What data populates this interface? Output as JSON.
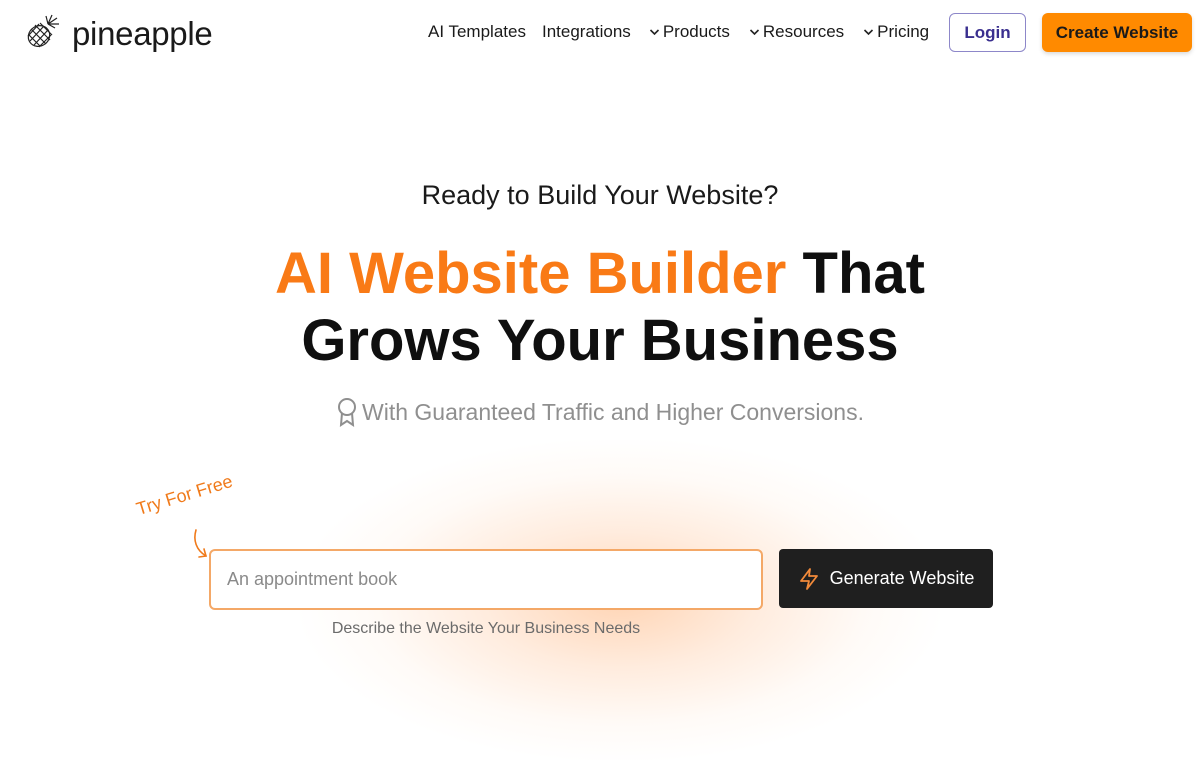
{
  "brand": {
    "name": "pineapple",
    "logo_icon": "pineapple-icon"
  },
  "nav": {
    "items": [
      {
        "label": "AI Templates",
        "has_dropdown": false
      },
      {
        "label": "Integrations",
        "has_dropdown": false
      },
      {
        "label": "Products",
        "has_dropdown": true
      },
      {
        "label": "Resources",
        "has_dropdown": true
      },
      {
        "label": "Pricing",
        "has_dropdown": true
      }
    ],
    "login_label": "Login",
    "create_label": "Create Website"
  },
  "hero": {
    "eyebrow": "Ready to Build Your Website?",
    "headline_accent": "AI Website Builder",
    "headline_rest_line1": "That",
    "headline_line2": "Grows Your Business",
    "tagline": "With Guaranteed Traffic and Higher Conversions.",
    "tagline_icon": "award-ribbon-icon"
  },
  "generator": {
    "try_label": "Try For Free",
    "input_placeholder": "An appointment book",
    "input_value": "",
    "button_label": "Generate Website",
    "button_icon": "lightning-icon",
    "helper_text": "Describe the Website Your Business Needs"
  },
  "colors": {
    "accent": "#f97a16",
    "create_button": "#ff8a00",
    "generate_button": "#1f1f1f",
    "login_text": "#3a2f8f"
  }
}
